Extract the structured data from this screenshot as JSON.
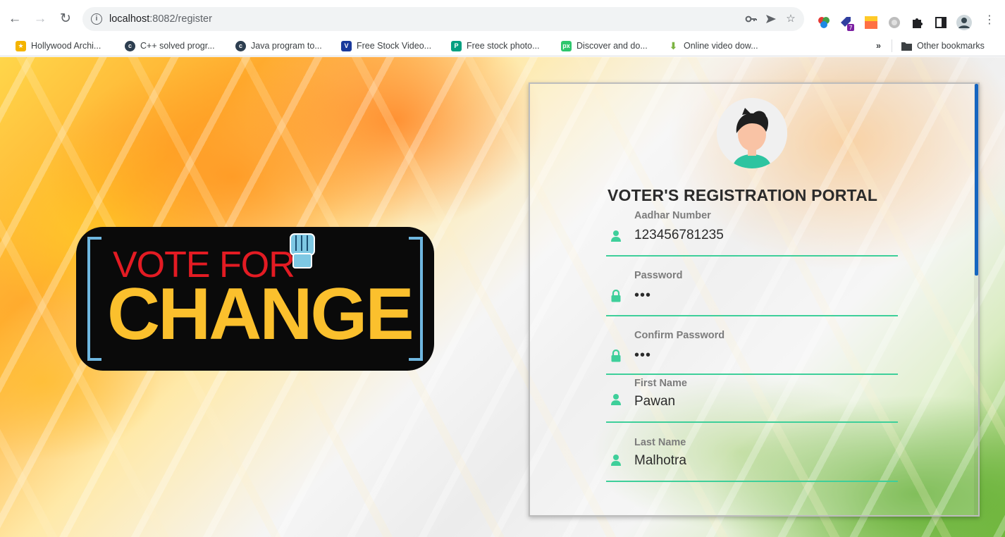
{
  "browser": {
    "url_host": "localhost",
    "url_path": ":8082/register",
    "bookmarks": [
      {
        "label": "Hollywood Archi...",
        "icon": "hollywood-icon",
        "color": "#f4b400"
      },
      {
        "label": "C++ solved progr...",
        "icon": "codeforwin-icon",
        "color": "#2d3e50"
      },
      {
        "label": "Java program to...",
        "icon": "codeforwin-icon",
        "color": "#2d3e50"
      },
      {
        "label": "Free Stock Video...",
        "icon": "videvo-icon",
        "color": "#1a3a9c"
      },
      {
        "label": "Free stock photo...",
        "icon": "pexels-icon",
        "color": "#05a081"
      },
      {
        "label": "Discover and do...",
        "icon": "pixabay-icon",
        "color": "#2ec66d"
      },
      {
        "label": "Online video dow...",
        "icon": "download-icon",
        "color": "#7cb342"
      }
    ],
    "other_bookmarks": "Other bookmarks",
    "overflow": "»"
  },
  "logo": {
    "line1": "VOTE FOR",
    "line2": "CHANGE"
  },
  "form": {
    "title": "VOTER'S REGISTRATION PORTAL",
    "fields": [
      {
        "label": "Aadhar Number",
        "value": "123456781235",
        "type": "text",
        "icon": "user-icon"
      },
      {
        "label": "Password",
        "value": "abc",
        "type": "password",
        "icon": "lock-icon"
      },
      {
        "label": "Confirm Password",
        "value": "abc",
        "type": "password",
        "icon": "lock-icon"
      },
      {
        "label": "First Name",
        "value": "Pawan",
        "type": "text",
        "icon": "user-icon"
      },
      {
        "label": "Last Name",
        "value": "Malhotra",
        "type": "text",
        "icon": "user-icon"
      }
    ]
  },
  "colors": {
    "accent": "#3ecf9a",
    "scroll_thumb": "#1565c0",
    "logo_red": "#e31b23",
    "logo_yellow": "#fbc02d",
    "logo_bracket": "#6fb7e0"
  }
}
